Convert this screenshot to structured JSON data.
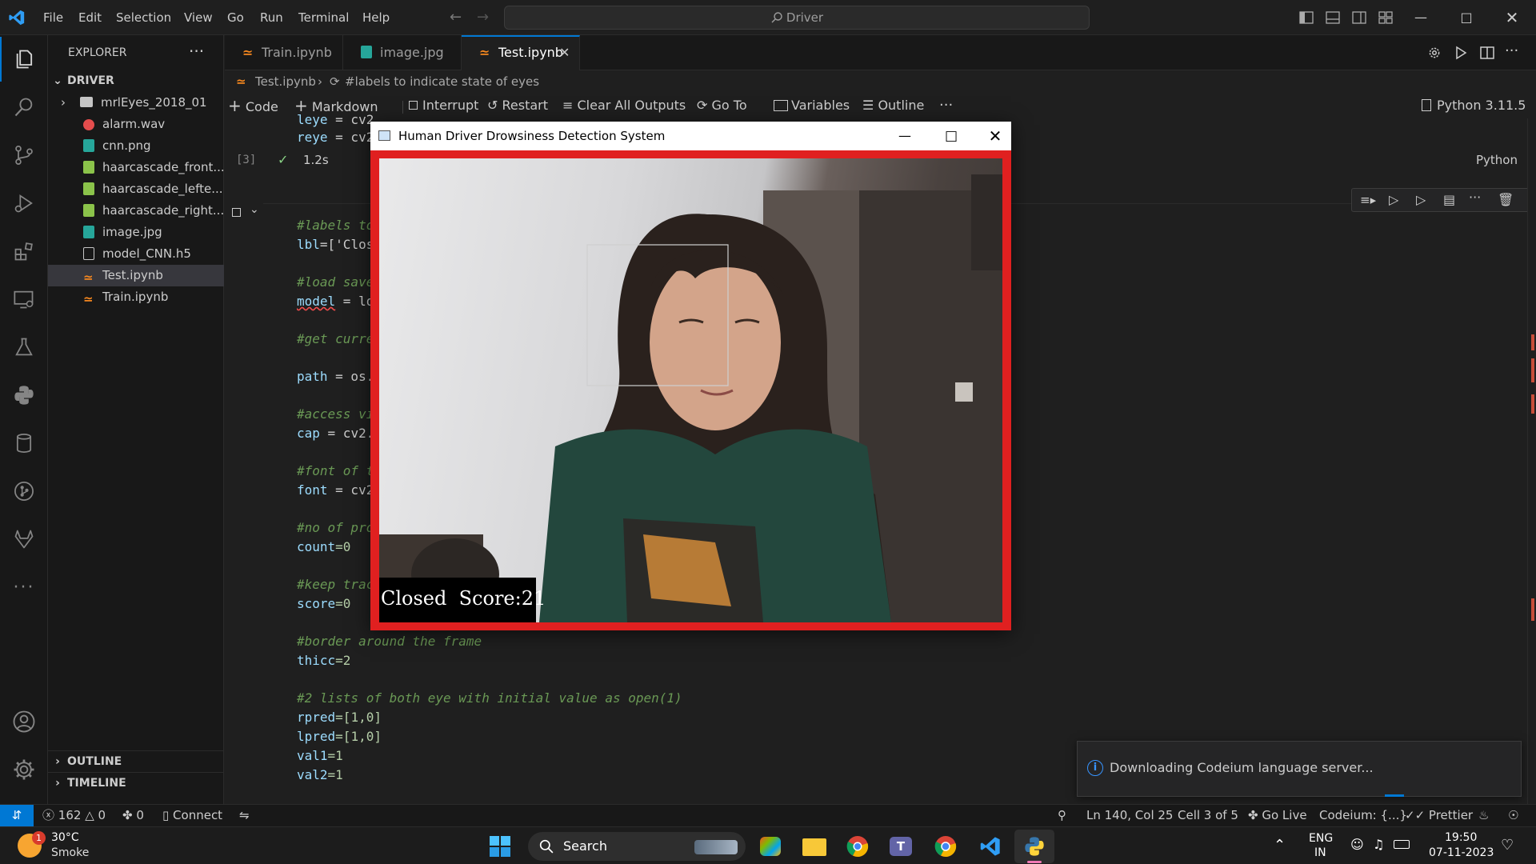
{
  "window": {
    "search": "Driver"
  },
  "menu": [
    "File",
    "Edit",
    "Selection",
    "View",
    "Go",
    "Run",
    "Terminal",
    "Help"
  ],
  "explorer": {
    "title": "EXPLORER",
    "folder": "DRIVER",
    "items": [
      "mrlEyes_2018_01",
      "alarm.wav",
      "cnn.png",
      "haarcascade_front...",
      "haarcascade_lefte...",
      "haarcascade_right...",
      "image.jpg",
      "model_CNN.h5",
      "Test.ipynb",
      "Train.ipynb"
    ],
    "outline": "OUTLINE",
    "timeline": "TIMELINE"
  },
  "tabs": [
    "Train.ipynb",
    "image.jpg",
    "Test.ipynb"
  ],
  "breadcrumb": {
    "file": "Test.ipynb",
    "cell": "#labels to indicate state of eyes"
  },
  "toolbar": {
    "code": "Code",
    "markdown": "Markdown",
    "interrupt": "Interrupt",
    "restart": "Restart",
    "clear": "Clear All Outputs",
    "goto": "Go To",
    "variables": "Variables",
    "outline": "Outline",
    "kernel": "Python 3.11.5"
  },
  "cell_prev": {
    "exec_count": "[3]",
    "time": "1.2s",
    "lang": "Python",
    "line1_var": "leye",
    "line1_rest": " = cv2",
    "line2_var": "reye",
    "line2_rest": " = cv2"
  },
  "code": {
    "c1": "#labels to",
    "c1v": "lbl",
    "c1r": "=['Clos",
    "c2": "#load save",
    "c2v": "model",
    "c2r": " = lo",
    "c3": "#get curre",
    "c4v": "path",
    "c4r": " = os.",
    "c5": "#access vi",
    "c5v": "cap",
    "c5r": " = cv2.",
    "c6": "#font of t",
    "c6v": "font",
    "c6r": " = cv2",
    "c7": "#no of pro",
    "c7v": "count",
    "c7r": "=0",
    "c8": "#keep trac",
    "c8v": "score",
    "c8r": "=0",
    "c9": "#border around the frame",
    "c9v": "thicc",
    "c9r": "=2",
    "c10": "#2 lists of both eye with initial value as open(1)",
    "c10a": "rpred",
    "c10ar": "=[1,0]",
    "c10b": "lpred",
    "c10br": "=[1,0]",
    "c10c": "val1",
    "c10cr": "=1",
    "c10d": "val2",
    "c10dr": "=1"
  },
  "cv_window": {
    "title": "Human Driver Drowsiness Detection System",
    "overlay": "Closed  Score:21"
  },
  "toast": {
    "message": "Downloading Codeium language server..."
  },
  "status": {
    "errors": "162",
    "warnings": "0",
    "ports": "0",
    "connect": "Connect",
    "position": "Ln 140, Col 25",
    "cell": "Cell 3 of 5",
    "golive": "Go Live",
    "codeium": "Codeium: {...}",
    "prettier": "Prettier"
  },
  "taskbar": {
    "temp": "30°C",
    "weather": "Smoke",
    "weather_badge": "1",
    "search": "Search",
    "lang1": "ENG",
    "lang2": "IN",
    "time": "19:50",
    "date": "07-11-2023"
  },
  "colors": {
    "accent": "#0078d4",
    "frame_border": "#e02020",
    "comment": "#6a9955",
    "variable": "#9cdcfe"
  }
}
